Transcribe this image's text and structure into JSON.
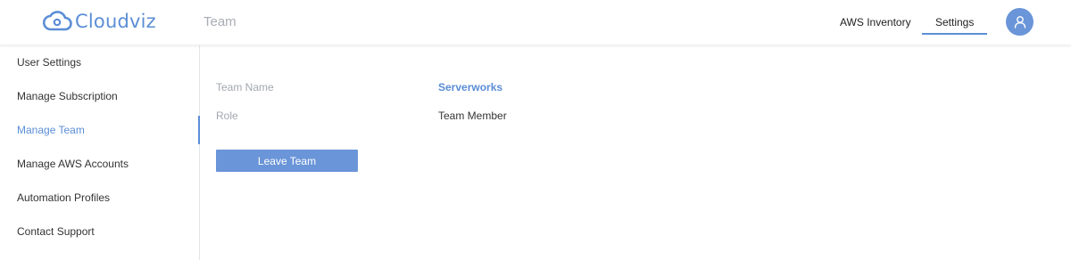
{
  "header": {
    "logo_text": "Cloudviz",
    "page_title": "Team",
    "nav": [
      {
        "label": "AWS Inventory",
        "active": false
      },
      {
        "label": "Settings",
        "active": true
      }
    ],
    "avatar_icon": "user-icon"
  },
  "sidebar": {
    "items": [
      {
        "label": "User Settings",
        "active": false
      },
      {
        "label": "Manage Subscription",
        "active": false
      },
      {
        "label": "Manage Team",
        "active": true
      },
      {
        "label": "Manage AWS Accounts",
        "active": false
      },
      {
        "label": "Automation Profiles",
        "active": false
      },
      {
        "label": "Contact Support",
        "active": false
      }
    ]
  },
  "team": {
    "name_label": "Team Name",
    "name_value": "Serverworks",
    "role_label": "Role",
    "role_value": "Team Member",
    "leave_button": "Leave Team"
  },
  "colors": {
    "accent": "#5b8ed6",
    "button": "#6a95d8"
  }
}
